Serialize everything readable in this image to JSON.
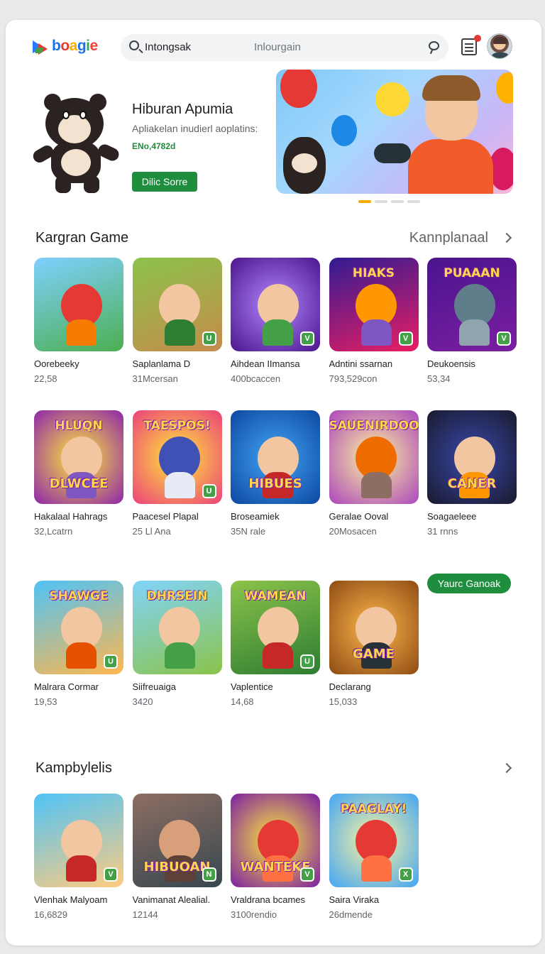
{
  "header": {
    "logo_letters": [
      "b",
      "o",
      "a",
      "g",
      "i",
      "e"
    ],
    "search_query": "Intongsak",
    "search_placeholder": "Inlourgain"
  },
  "hero": {
    "title": "Hiburan Apumia",
    "subtitle": "Apliakelan inudierl aoplatins:",
    "tag": "ENo,4782d",
    "button": "Dilic Sorre",
    "carousel_pages": 4,
    "carousel_active": 0
  },
  "section1": {
    "title": "Kargran Game",
    "more": "Kannplanaal",
    "rows": [
      [
        {
          "name": "Oorebeeky",
          "meta": "22,58",
          "bg": "linear-gradient(160deg,#7fd0ff,#4caf50)",
          "c1": "#e53935",
          "c2": "#f57c00"
        },
        {
          "name": "Saplanlama D",
          "meta": "31Mcersan",
          "bg": "linear-gradient(160deg,#8bc34a,#c58b4b)",
          "c1": "#f2c6a0",
          "c2": "#2e7d32",
          "badge": "U"
        },
        {
          "name": "Aihdean IImansa",
          "meta": "400bcaccen",
          "bg": "radial-gradient(circle,#b388ff,#4a148c)",
          "c1": "#f2c6a0",
          "c2": "#43a047",
          "badge": "V"
        },
        {
          "name": "Adntini ssarnan",
          "meta": "793,529con",
          "bg": "linear-gradient(160deg,#311b92,#e91e63)",
          "c1": "#ff9800",
          "c2": "#7e57c2",
          "word": "HIAKS",
          "badge": "V"
        },
        {
          "name": "Deukoensis",
          "meta": "53,34",
          "bg": "linear-gradient(160deg,#4a148c,#7b1fa2)",
          "c1": "#607d8b",
          "c2": "#90a4ae",
          "word": "PUAAAN",
          "badge": "V"
        }
      ],
      [
        {
          "name": "Hakalaal Hahrags",
          "meta": "32,Lcatrn",
          "bg": "radial-gradient(circle,#ffeb3b,#8e24aa)",
          "c1": "#f2c6a0",
          "c2": "#7e57c2",
          "word": "HLUQN",
          "bottom": "DLWCEE"
        },
        {
          "name": "Paacesel Plapal",
          "meta": "25 Ll Ana",
          "bg": "radial-gradient(circle,#ffeb3b,#ec407a)",
          "c1": "#3f51b5",
          "c2": "#e8eaf6",
          "word": "TAESPOS!",
          "badge": "U"
        },
        {
          "name": "Broseamiek",
          "meta": "35N rale",
          "bg": "radial-gradient(circle,#42a5f5,#0d47a1)",
          "c1": "#f2c6a0",
          "c2": "#c62828",
          "bottom": "HIBUES"
        },
        {
          "name": "Geralae Ooval",
          "meta": "20Mosacen",
          "bg": "radial-gradient(circle,#fff59d,#ab47bc)",
          "c1": "#ef6c00",
          "c2": "#8d6e63",
          "word": "SAUENIRDOO"
        },
        {
          "name": "Soagaeleee",
          "meta": "31 rnns",
          "bg": "radial-gradient(circle,#3949ab,#1a1a2e)",
          "c1": "#f2c6a0",
          "c2": "#ff9800",
          "bottom": "CANER"
        }
      ],
      [
        {
          "name": "Malrara Cormar",
          "meta": "19,53",
          "bg": "linear-gradient(160deg,#4fc3f7,#ffb74d)",
          "c1": "#f2c6a0",
          "c2": "#e65100",
          "word": "SHAWGE",
          "badge": "U"
        },
        {
          "name": "Siifreuaiga",
          "meta": "3420",
          "bg": "linear-gradient(160deg,#81d4fa,#8bc34a)",
          "c1": "#f2c6a0",
          "c2": "#43a047",
          "word": "DHRSEIN"
        },
        {
          "name": "Vaplentice",
          "meta": "14,68",
          "bg": "linear-gradient(160deg,#8bc34a,#2e7d32)",
          "c1": "#f2c6a0",
          "c2": "#c62828",
          "word": "WAMEAN",
          "badge": "U"
        },
        {
          "name": "Declarang",
          "meta": "15,033",
          "bg": "radial-gradient(circle,#ffb74d,#8d4b12)",
          "c1": "#f2c6a0",
          "c2": "#263238",
          "bottom": "GAME"
        }
      ]
    ],
    "chip": "Yaurc Ganoak"
  },
  "section2": {
    "title": "Kampbylelis",
    "items": [
      {
        "name": "Vlenhak Malyoam",
        "meta": "16,6829",
        "bg": "linear-gradient(160deg,#4fc3f7,#ffcc80)",
        "c1": "#f2c6a0",
        "c2": "#c62828",
        "badge": "V"
      },
      {
        "name": "Vanimanat Alealial.",
        "meta": "12144",
        "bg": "linear-gradient(160deg,#8d6e63,#37474f)",
        "c1": "#d7a07a",
        "c2": "#5d4037",
        "bottom": "HIBUOAN",
        "badge": "N"
      },
      {
        "name": "Vraldrana bcames",
        "meta": "3100rendio",
        "bg": "radial-gradient(circle,#ffeb3b,#7b1fa2)",
        "c1": "#e53935",
        "c2": "#ff7043",
        "bottom": "WANTEKE",
        "badge": "V"
      },
      {
        "name": "Saira Viraka",
        "meta": "26dmende",
        "bg": "radial-gradient(circle,#fff59d,#42a5f5)",
        "c1": "#e53935",
        "c2": "#ff7043",
        "word": "PAAGLAY!",
        "badge": "X"
      }
    ]
  }
}
